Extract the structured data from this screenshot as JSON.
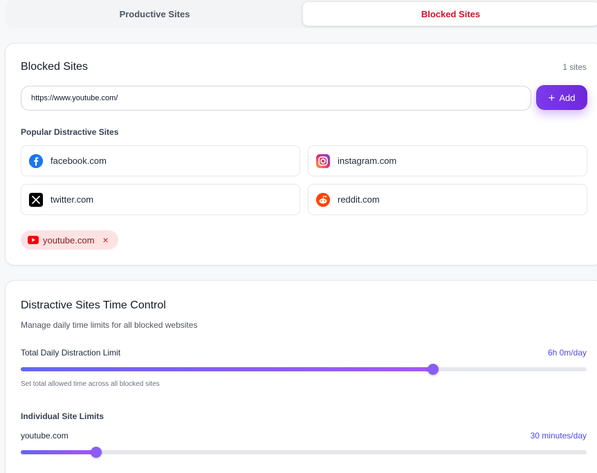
{
  "tabs": [
    {
      "label": "Productive Sites",
      "active": false
    },
    {
      "label": "Blocked Sites",
      "active": true
    }
  ],
  "blocked": {
    "title": "Blocked Sites",
    "count": "1 sites",
    "input_value": "https://www.youtube.com/",
    "add_label": "Add",
    "popular_label": "Popular Distractive Sites",
    "popular": [
      {
        "name": "facebook.com",
        "icon": "facebook-icon"
      },
      {
        "name": "instagram.com",
        "icon": "instagram-icon"
      },
      {
        "name": "twitter.com",
        "icon": "x-twitter-icon"
      },
      {
        "name": "reddit.com",
        "icon": "reddit-icon"
      }
    ],
    "chips": [
      {
        "name": "youtube.com",
        "icon": "youtube-icon",
        "remove": "×"
      }
    ]
  },
  "time_control": {
    "title": "Distractive Sites Time Control",
    "subtitle": "Manage daily time limits for all blocked websites",
    "total_label": "Total Daily Distraction Limit",
    "total_value": "6h 0m/day",
    "total_fraction": 0.729,
    "total_hint": "Set total allowed time across all blocked sites",
    "individual_label": "Individual Site Limits",
    "sites": [
      {
        "name": "youtube.com",
        "value": "30 minutes/day",
        "fraction": 0.133
      }
    ]
  },
  "colors": {
    "accent": "#7c3aed",
    "active_tab": "#d0112b",
    "chip_bg": "#fde2e4",
    "value_text": "#4f46e5"
  }
}
